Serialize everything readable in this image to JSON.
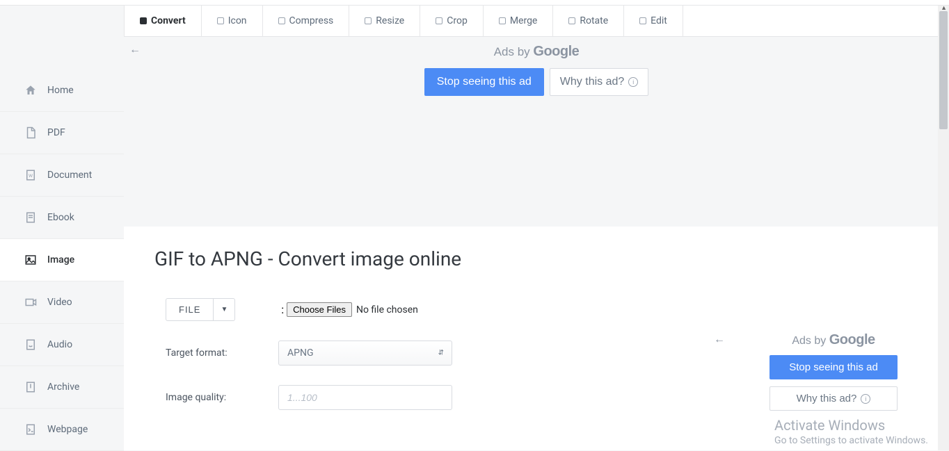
{
  "sidebar": {
    "items": [
      {
        "label": "Home",
        "icon": "home"
      },
      {
        "label": "PDF",
        "icon": "pdf"
      },
      {
        "label": "Document",
        "icon": "doc"
      },
      {
        "label": "Ebook",
        "icon": "ebook"
      },
      {
        "label": "Image",
        "icon": "image"
      },
      {
        "label": "Video",
        "icon": "video"
      },
      {
        "label": "Audio",
        "icon": "audio"
      },
      {
        "label": "Archive",
        "icon": "archive"
      },
      {
        "label": "Webpage",
        "icon": "webpage"
      }
    ]
  },
  "tabs": [
    {
      "label": "Convert",
      "active": true
    },
    {
      "label": "Icon"
    },
    {
      "label": "Compress"
    },
    {
      "label": "Resize"
    },
    {
      "label": "Crop"
    },
    {
      "label": "Merge"
    },
    {
      "label": "Rotate"
    },
    {
      "label": "Edit"
    }
  ],
  "ad": {
    "byline": "Ads by",
    "brand": "Google",
    "stop": "Stop seeing this ad",
    "why": "Why this ad?"
  },
  "page": {
    "title": "GIF to APNG - Convert image online"
  },
  "form": {
    "file_button": "FILE",
    "file_colon": ":",
    "choose_files": "Choose Files",
    "no_file": "No file chosen",
    "target_label": "Target format:",
    "target_value": "APNG",
    "quality_label": "Image quality:",
    "quality_placeholder": "1...100"
  },
  "windows": {
    "title": "Activate Windows",
    "sub": "Go to Settings to activate Windows."
  }
}
